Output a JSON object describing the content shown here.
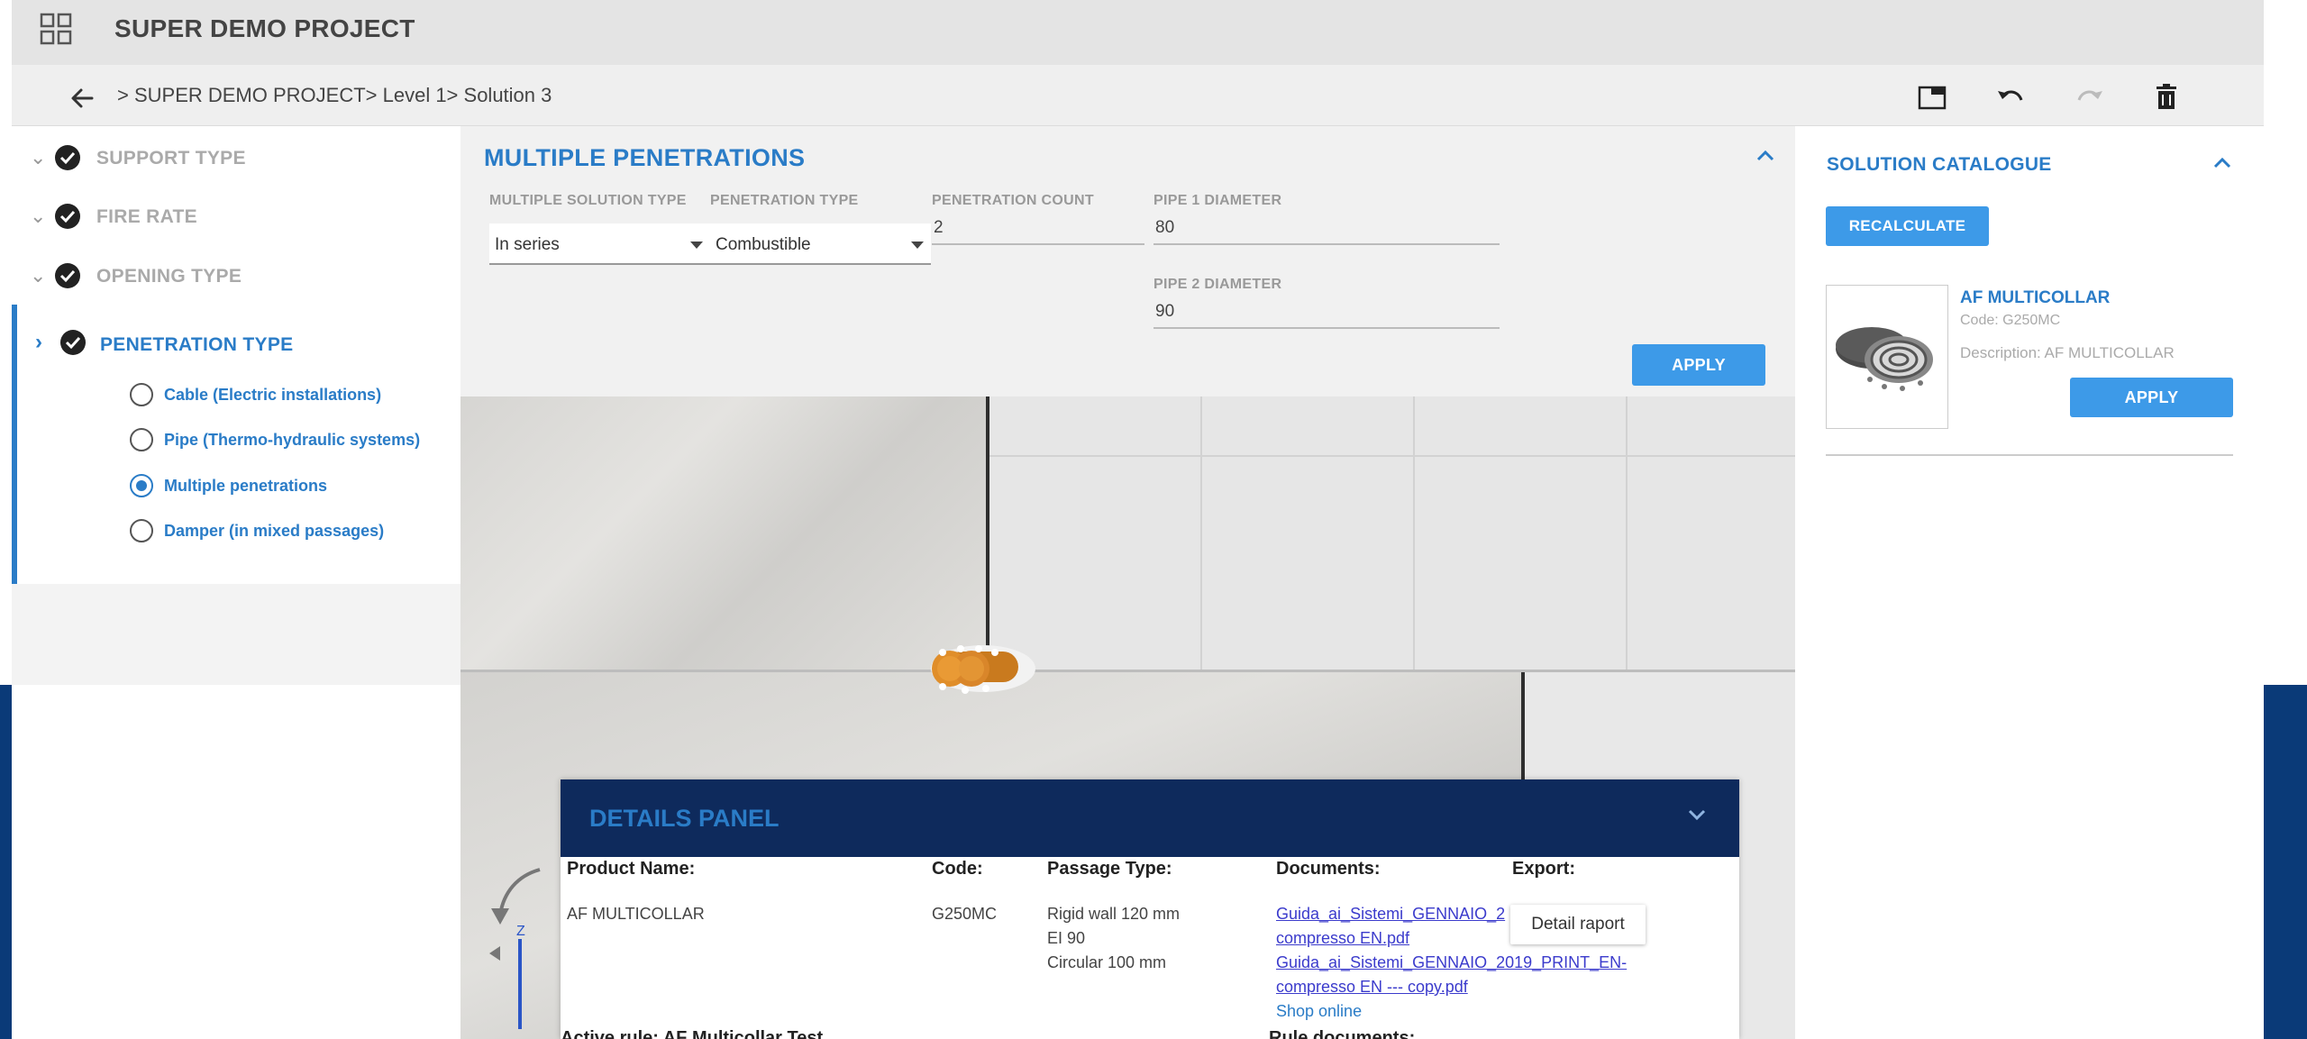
{
  "app": {
    "project_title": "SUPER DEMO PROJECT",
    "breadcrumb": "> SUPER DEMO PROJECT> Level 1> Solution 3"
  },
  "steps": [
    {
      "label": "SUPPORT TYPE"
    },
    {
      "label": "FIRE RATE"
    },
    {
      "label": "OPENING TYPE"
    },
    {
      "label": "PENETRATION TYPE"
    }
  ],
  "penetration_options": [
    {
      "label": "Cable (Electric installations)",
      "selected": false
    },
    {
      "label": "Pipe (Thermo-hydraulic systems)",
      "selected": false
    },
    {
      "label": "Multiple penetrations",
      "selected": true
    },
    {
      "label": "Damper (in mixed passages)",
      "selected": false
    }
  ],
  "config": {
    "title": "MULTIPLE PENETRATIONS",
    "multiple_solution_type_label": "MULTIPLE SOLUTION TYPE",
    "multiple_solution_type_value": "In series",
    "penetration_type_label": "PENETRATION TYPE",
    "penetration_type_value": "Combustible",
    "penetration_count_label": "PENETRATION COUNT",
    "penetration_count_value": "2",
    "pipe1_label": "PIPE 1 DIAMETER",
    "pipe1_value": "80",
    "pipe2_label": "PIPE 2 DIAMETER",
    "pipe2_value": "90",
    "apply_label": "APPLY"
  },
  "catalogue": {
    "title": "SOLUTION CATALOGUE",
    "recalculate_label": "RECALCULATE",
    "product_name": "AF MULTICOLLAR",
    "product_code": "Code: G250MC",
    "product_description": "Description: AF MULTICOLLAR",
    "apply_label": "APPLY"
  },
  "details": {
    "title": "DETAILS PANEL",
    "headers": {
      "product_name": "Product Name:",
      "code": "Code:",
      "passage_type": "Passage Type:",
      "documents": "Documents:",
      "export": "Export:"
    },
    "product_name": "AF MULTICOLLAR",
    "code": "G250MC",
    "passage_lines": [
      "Rigid wall 120 mm",
      "EI 90",
      "Circular 100 mm"
    ],
    "doc1_line1": "Guida_ai_Sistemi_GENNAIO_2",
    "doc1_line2": "compresso EN.pdf",
    "doc2_line1": "Guida_ai_Sistemi_GENNAIO_2019_PRINT_EN-",
    "doc2_line2": "compresso EN --- copy.pdf",
    "shop_online": "Shop online",
    "detail_report": "Detail raport",
    "active_rule": "Active rule: AF Multicollar Test",
    "rule_documents": "Rule documents:"
  },
  "icons": {
    "apps": "apps-grid-icon",
    "back": "arrow-left-icon",
    "window": "window-icon",
    "undo": "undo-icon",
    "redo": "redo-icon",
    "delete": "trash-icon"
  },
  "colors": {
    "accent": "#2a7cc7",
    "button": "#3d9ae8",
    "details_header": "#0e2a5c",
    "page_blue": "#0a3a78"
  }
}
